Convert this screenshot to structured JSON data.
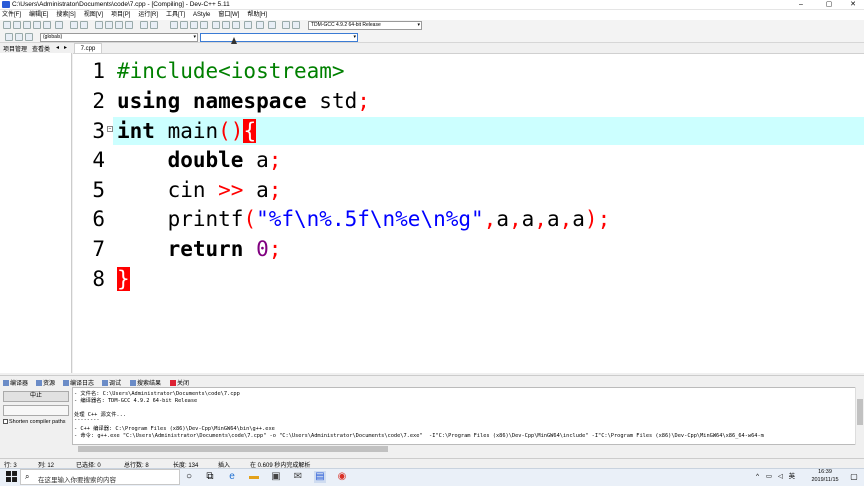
{
  "window": {
    "title": "C:\\Users\\Administrator\\Documents\\code\\7.cpp - [Compiling] - Dev-C++ 5.11",
    "minimize_glyph": "–",
    "maximize_glyph": "▢",
    "close_glyph": "✕"
  },
  "menu": [
    "文件[F]",
    "编辑[E]",
    "搜索[S]",
    "视图[V]",
    "项目[P]",
    "运行[R]",
    "工具[T]",
    "AStyle",
    "窗口[W]",
    "帮助[H]"
  ],
  "toolbar": {
    "compiler_select": "TDM-GCC 4.9.2 64-bit Release",
    "globals_select": "(globals)",
    "function_select": ""
  },
  "left_panel": {
    "tabs": [
      "项目管理",
      "查看类"
    ],
    "nav_prev": "◂",
    "nav_next": "▸"
  },
  "editor": {
    "file_tab": "7.cpp",
    "line_numbers": [
      "1",
      "2",
      "3",
      "4",
      "5",
      "6",
      "7",
      "8"
    ],
    "fold_glyph": "−"
  },
  "bottom_tabs": [
    "编译器",
    "资源",
    "编译日志",
    "调试",
    "搜索结果",
    "关闭"
  ],
  "compile_panel": {
    "stop_button": "中止",
    "shorten_paths_label": "Shorten compiler paths",
    "log_lines": [
      "- 文件名: C:\\Users\\Administrator\\Documents\\code\\7.cpp",
      "- 编译器名: TDM-GCC 4.9.2 64-bit Release",
      "",
      "处理 C++ 源文件...",
      "--------",
      "- C++ 编译器: C:\\Program Files (x86)\\Dev-Cpp\\MinGW64\\bin\\g++.exe",
      "- 命令: g++.exe \"C:\\Users\\Administrator\\Documents\\code\\7.cpp\" -o \"C:\\Users\\Administrator\\Documents\\code\\7.exe\"  -I\"C:\\Program Files (x86)\\Dev-Cpp\\MinGW64\\include\" -I\"C:\\Program Files (x86)\\Dev-Cpp\\MinGW64\\x86_64-w64-m"
    ]
  },
  "status": {
    "row_label": "行: 3",
    "col_label": "列: 12",
    "selected_label": "已选择: 0",
    "total_lines_label": "总行数: 8",
    "length_label": "长度: 134",
    "mode": "插入",
    "parse_msg": "在 0.609 秒内完成解析"
  },
  "taskbar": {
    "search_placeholder": "在这里输入你要搜索的内容",
    "tray_caret": "^",
    "ime": "英",
    "time": "16:39",
    "date": "2019/11/15"
  },
  "colors": {
    "keyword": "#000000",
    "preprocessor": "#008000",
    "symbol": "#ff0000",
    "string": "#0000ff",
    "number": "#800080",
    "current_line": "#ccffff"
  }
}
